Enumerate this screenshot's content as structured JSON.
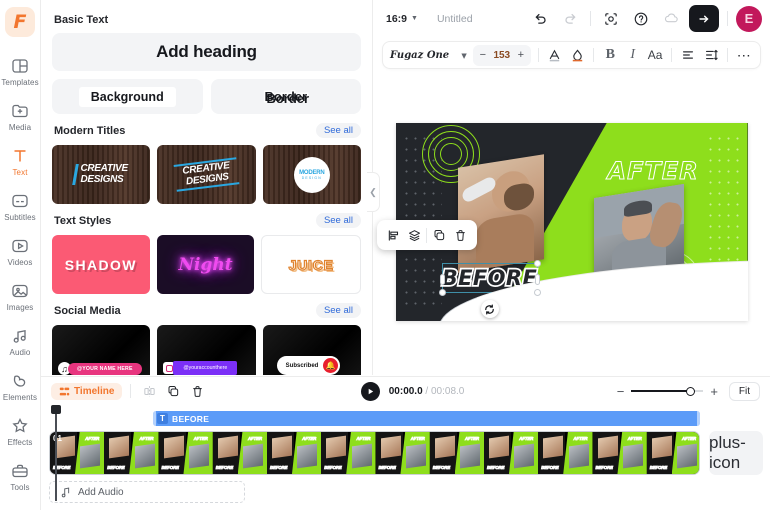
{
  "app": {
    "logo_letter": "F"
  },
  "rail": {
    "items": [
      {
        "label": "Templates",
        "icon": "templates-icon",
        "active": false
      },
      {
        "label": "Media",
        "icon": "media-icon",
        "active": false
      },
      {
        "label": "Text",
        "icon": "text-icon",
        "active": true
      },
      {
        "label": "Subtitles",
        "icon": "subtitles-icon",
        "active": false
      },
      {
        "label": "Videos",
        "icon": "videos-icon",
        "active": false
      },
      {
        "label": "Images",
        "icon": "images-icon",
        "active": false
      },
      {
        "label": "Audio",
        "icon": "audio-icon",
        "active": false
      },
      {
        "label": "Elements",
        "icon": "elements-icon",
        "active": false
      },
      {
        "label": "Effects",
        "icon": "effects-icon",
        "active": false
      },
      {
        "label": "Tools",
        "icon": "tools-icon",
        "active": false
      }
    ]
  },
  "panel": {
    "basic_text": {
      "title": "Basic Text",
      "add_heading": "Add heading",
      "background": "Background",
      "border": "Border"
    },
    "modern_titles": {
      "title": "Modern Titles",
      "see_all": "See all",
      "cards": [
        {
          "line1": "CREATIVE",
          "line2": "DESIGNS"
        },
        {
          "line1": "CREATIVE",
          "line2": "DESIGNS"
        },
        {
          "line1": "MODERN",
          "line2": "DESIGN"
        }
      ]
    },
    "text_styles": {
      "title": "Text Styles",
      "see_all": "See all",
      "cards": [
        {
          "label": "SHADOW"
        },
        {
          "label": "Night"
        },
        {
          "label": "JUICE"
        }
      ]
    },
    "social_media": {
      "title": "Social Media",
      "see_all": "See all",
      "cards": [
        {
          "label": "@YOUR NAME HERE",
          "icon": "tiktok-icon"
        },
        {
          "label": "@youraccounthere",
          "icon": "instagram-icon"
        },
        {
          "label": "Subscribed",
          "icon": "bell-icon"
        }
      ]
    },
    "collapse_icon": "chevron-left-icon"
  },
  "topbar": {
    "ratio": "16:9",
    "doc_title": "Untitled",
    "undo_icon": "undo-icon",
    "redo_icon": "redo-icon",
    "record_icon": "record-icon",
    "help_icon": "help-icon",
    "cloud_icon": "cloud-icon",
    "export_icon": "arrow-right-icon",
    "avatar_letter": "E"
  },
  "formatbar": {
    "font_family": "Fugaz One",
    "font_size": "153",
    "minus": "−",
    "plus": "+",
    "text_color_icon": "text-color-icon",
    "highlight_icon": "highlight-color-icon",
    "bold": "B",
    "italic": "I",
    "case": "Aa",
    "align_icon": "align-left-icon",
    "spacing_icon": "line-spacing-icon",
    "more": "⋯"
  },
  "canvas": {
    "before_text": "BEFORE",
    "after_text": "AFTER",
    "rotate_icon": "rotate-icon",
    "float_toolbar": [
      {
        "name": "align-icon"
      },
      {
        "name": "layers-icon"
      },
      {
        "name": "duplicate-icon"
      },
      {
        "name": "delete-icon"
      }
    ],
    "green": "#8ede1c",
    "dark": "#23262b",
    "selection_color": "#3f8fa8"
  },
  "timeline": {
    "chip_label": "Timeline",
    "split_icon": "split-icon",
    "duplicate_icon": "duplicate-icon",
    "delete_icon": "delete-icon",
    "play_icon": "play-icon",
    "current_time": "00:00.0",
    "separator": " / ",
    "total_time": "00:08.0",
    "zoom_out": "−",
    "zoom_in": "+",
    "fit_label": "Fit",
    "text_clip_label": "BEFORE",
    "text_clip_icon": "T",
    "clip_number": "01",
    "frame_before_label": "BEFORE",
    "frame_after_label": "AFTER",
    "add_audio_label": "Add Audio",
    "add_audio_icon": "music-note-icon",
    "add_track_icon": "plus-icon"
  }
}
